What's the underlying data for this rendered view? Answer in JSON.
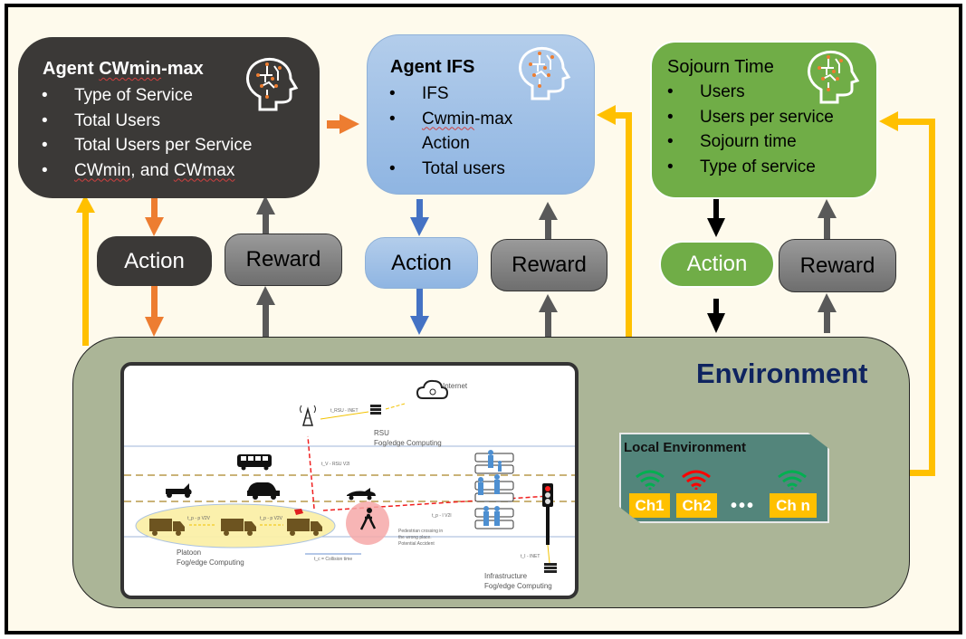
{
  "agents": {
    "cwminmax": {
      "title": "Agent CWmin-max",
      "items": [
        "Type of Service",
        "Total Users",
        "Total Users per Service",
        "CWmin, and CWmax"
      ],
      "icon": "brain-circuit-icon",
      "colors": {
        "fill": "#3b3937",
        "text": "#ffffff"
      }
    },
    "ifs": {
      "title": "Agent IFS",
      "items": [
        "IFS",
        "Cwmin-max",
        "Action",
        "Total users"
      ],
      "icon": "brain-circuit-icon",
      "colors": {
        "fill": "#9dbfe6",
        "text": "#000000"
      }
    },
    "sojourn": {
      "title": "Sojourn Time",
      "items": [
        "Users",
        "Users per service",
        "Sojourn time",
        "Type of service"
      ],
      "icon": "brain-circuit-icon",
      "colors": {
        "fill": "#70ad47",
        "text": "#000000"
      }
    }
  },
  "loops": {
    "cwminmax": {
      "action": "Action",
      "reward": "Reward",
      "arrow_color": "#ed7d31"
    },
    "ifs": {
      "action": "Action",
      "reward": "Reward",
      "arrow_color": "#4472c4"
    },
    "sojourn": {
      "action": "Action",
      "reward": "Reward",
      "arrow_color": "#000000"
    }
  },
  "arrow_colors": {
    "feedback": "#ffc000",
    "reward": "#595959",
    "agent_link": "#ed7d31"
  },
  "environment": {
    "title": "Environment",
    "title_color": "#0f2460",
    "scene": {
      "internet_label": "Internet",
      "rsu_label": "RSU",
      "rsu_sub": "Fog/edge Computing",
      "link_rsu": "t_RSU - INET",
      "link_v2i": "t_V - RSU V2I",
      "link_v2v_1": "t_p - p V2V",
      "link_v2v_2": "t_p - p V2V",
      "link_v2i_2": "t_p - I V2I",
      "link_infra": "t_I - INET",
      "platoon_label": "Platoon",
      "platoon_sub": "Fog/edge Computing",
      "pedestrian_text_1": "Pedestrian crossing in",
      "pedestrian_text_2": "the wrong place.",
      "pedestrian_text_3": "Potential Accident",
      "collision_label": "t_c = Collision time",
      "infra_label": "Infrastructure",
      "infra_sub": "Fog/edge Computing"
    },
    "local": {
      "title": "Local Environment",
      "channels": [
        {
          "label": "Ch1",
          "status": "free",
          "color": "#00b050"
        },
        {
          "label": "Ch2",
          "status": "busy",
          "color": "#ff0000"
        },
        {
          "label": "Ch n",
          "status": "free",
          "color": "#00b050"
        }
      ],
      "ellipsis": "•••"
    }
  }
}
